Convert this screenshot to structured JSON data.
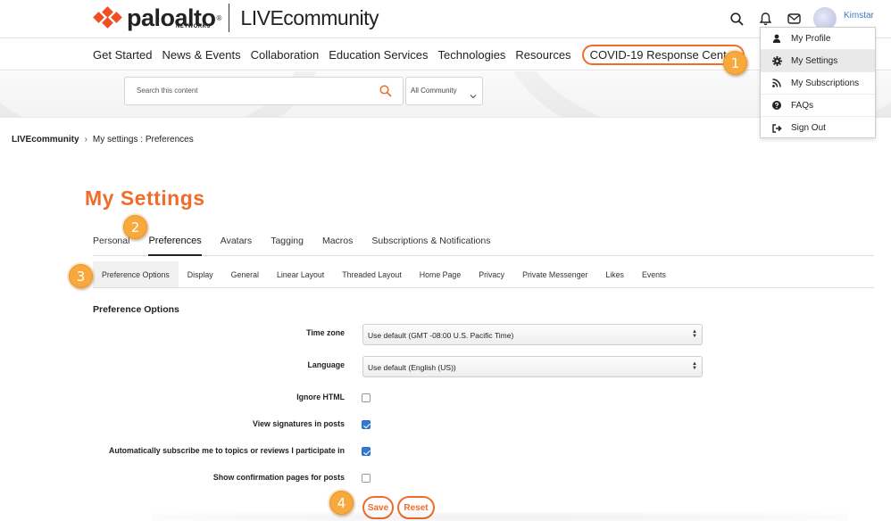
{
  "header": {
    "brand_name": "paloalto",
    "brand_sub": "NETWORKS",
    "brand_reg": "®",
    "community_live": "LIVE",
    "community_rest": "community",
    "username": "Kimstar"
  },
  "nav": {
    "items": [
      {
        "label": "Get Started"
      },
      {
        "label": "News & Events"
      },
      {
        "label": "Collaboration"
      },
      {
        "label": "Education Services"
      },
      {
        "label": "Technologies"
      },
      {
        "label": "Resources"
      }
    ],
    "highlight": "COVID-19 Response Center"
  },
  "search": {
    "placeholder": "Search this content",
    "scope": "All Community"
  },
  "breadcrumb": {
    "root": "LIVEcommunity",
    "separator": "›",
    "current": "My settings : Preferences"
  },
  "page": {
    "title": "My Settings"
  },
  "tabs": [
    {
      "label": "Personal"
    },
    {
      "label": "Preferences"
    },
    {
      "label": "Avatars"
    },
    {
      "label": "Tagging"
    },
    {
      "label": "Macros"
    },
    {
      "label": "Subscriptions & Notifications"
    }
  ],
  "subtabs": [
    {
      "label": "Preference Options"
    },
    {
      "label": "Display"
    },
    {
      "label": "General"
    },
    {
      "label": "Linear Layout"
    },
    {
      "label": "Threaded Layout"
    },
    {
      "label": "Home Page"
    },
    {
      "label": "Privacy"
    },
    {
      "label": "Private Messenger"
    },
    {
      "label": "Likes"
    },
    {
      "label": "Events"
    }
  ],
  "form": {
    "heading": "Preference Options",
    "timezone_label": "Time zone",
    "timezone_value": "Use default (GMT -08:00 U.S. Pacific Time)",
    "language_label": "Language",
    "language_value": "Use default (English (US))",
    "ignore_html_label": "Ignore HTML",
    "ignore_html_checked": false,
    "signatures_label": "View signatures in posts",
    "signatures_checked": true,
    "autosubscribe_label": "Automatically subscribe me to topics or reviews I participate in",
    "autosubscribe_checked": true,
    "confirmation_label": "Show confirmation pages for posts",
    "confirmation_checked": false,
    "save_label": "Save",
    "reset_label": "Reset"
  },
  "user_menu": {
    "items": [
      {
        "label": "My Profile",
        "icon": "user-icon"
      },
      {
        "label": "My Settings",
        "icon": "gear-icon"
      },
      {
        "label": "My Subscriptions",
        "icon": "rss-icon"
      },
      {
        "label": "FAQs",
        "icon": "question-icon"
      },
      {
        "label": "Sign Out",
        "icon": "sign-out-icon"
      }
    ]
  },
  "markers": [
    "1",
    "2",
    "3",
    "4"
  ],
  "colors": {
    "accent": "#f06c2a",
    "marker": "#f7a93b",
    "link": "#3b7bbf",
    "checkbox": "#2f7bd6"
  }
}
